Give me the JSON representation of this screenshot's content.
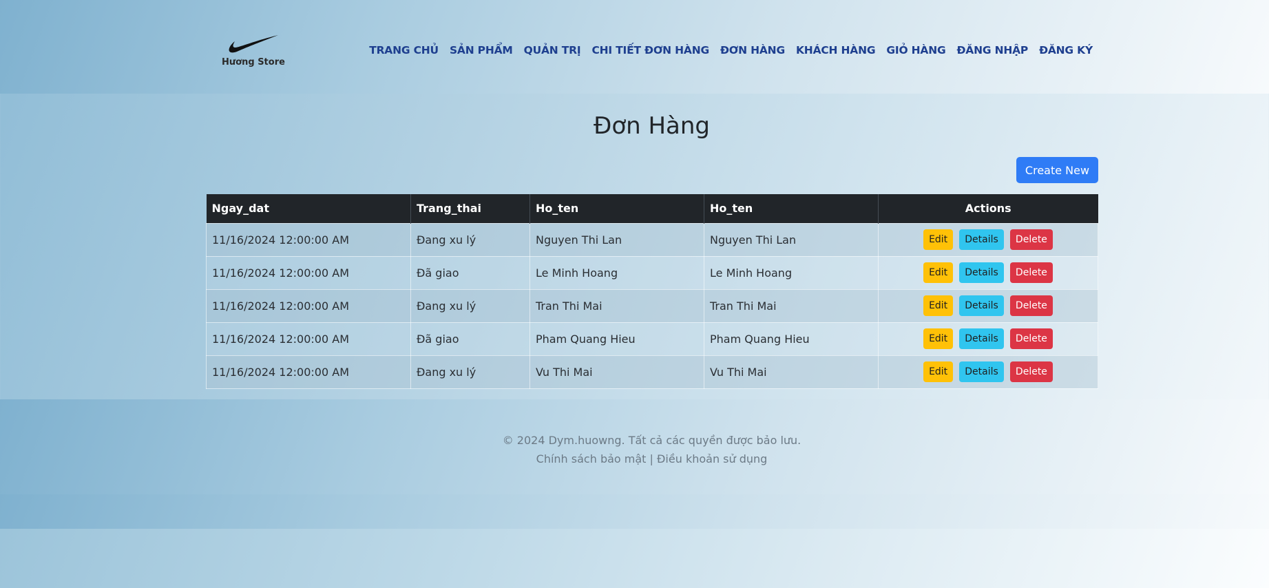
{
  "header": {
    "brand_name": "Hương Store",
    "nav": [
      "TRANG CHỦ",
      "SẢN PHẨM",
      "QUẢN TRỊ",
      "CHI TIẾT ĐƠN HÀNG",
      "ĐƠN HÀNG",
      "KHÁCH HÀNG",
      "GIỎ HÀNG",
      "ĐĂNG NHẬP",
      "ĐĂNG KÝ"
    ]
  },
  "main": {
    "title": "Đơn Hàng",
    "create_label": "Create New",
    "columns": [
      "Ngay_dat",
      "Trang_thai",
      "Ho_ten",
      "Ho_ten",
      "Actions"
    ],
    "rows": [
      [
        "11/16/2024 12:00:00 AM",
        "Đang xu lý",
        "Nguyen Thi Lan",
        "Nguyen Thi Lan"
      ],
      [
        "11/16/2024 12:00:00 AM",
        "Đã giao",
        "Le Minh Hoang",
        "Le Minh Hoang"
      ],
      [
        "11/16/2024 12:00:00 AM",
        "Đang xu lý",
        "Tran Thi Mai",
        "Tran Thi Mai"
      ],
      [
        "11/16/2024 12:00:00 AM",
        "Đã giao",
        "Pham Quang Hieu",
        "Pham Quang Hieu"
      ],
      [
        "11/16/2024 12:00:00 AM",
        "Đang xu lý",
        "Vu Thi Mai",
        "Vu Thi Mai"
      ]
    ],
    "actions": {
      "edit": "Edit",
      "details": "Details",
      "delete": "Delete"
    }
  },
  "footer": {
    "copyright": "© 2024 Dym.huowng. Tất cả các quyền được bảo lưu.",
    "privacy": "Chính sách bảo mật",
    "separator": "|",
    "terms": "Điều khoản sử dụng"
  },
  "colors": {
    "nav_link": "#1e3f8f",
    "primary_button": "#2f7cf6",
    "edit_button": "#ffc107",
    "details_button": "#30c5ef",
    "delete_button": "#dc3545",
    "table_header": "#212529"
  },
  "icons": {
    "logo": "swoosh-logo-icon"
  }
}
